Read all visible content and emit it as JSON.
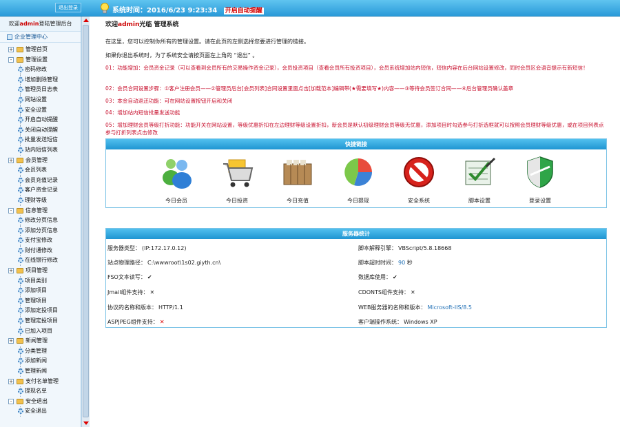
{
  "topbar": {
    "logout_label": "退出登录",
    "system_time": "系统时间：2016/6/23 9:23:34",
    "remind_label": "开启自动提醒"
  },
  "sidebar": {
    "welcome_prefix": "欢迎",
    "welcome_user": "admin",
    "welcome_suffix": "登陆管理后台",
    "center_title": "企业管理中心",
    "items": [
      {
        "type": "top",
        "pm": "+",
        "label": "管理首页"
      },
      {
        "type": "top",
        "pm": "-",
        "label": "管理设置"
      },
      {
        "type": "sub",
        "label": "密码修改"
      },
      {
        "type": "sub",
        "label": "增加删除管理"
      },
      {
        "type": "sub",
        "label": "管理员日志表"
      },
      {
        "type": "sub",
        "label": "网站设置"
      },
      {
        "type": "sub",
        "label": "安全设置"
      },
      {
        "type": "sub",
        "label": "开启自动提醒"
      },
      {
        "type": "sub",
        "label": "关闭自动提醒"
      },
      {
        "type": "sub",
        "label": "批量发送短信"
      },
      {
        "type": "sub",
        "label": "站内短信列表"
      },
      {
        "type": "top",
        "pm": "+",
        "label": "会员管理"
      },
      {
        "type": "sub",
        "label": "会员列表"
      },
      {
        "type": "sub",
        "label": "会员充值记录"
      },
      {
        "type": "sub",
        "label": "客户资金记录"
      },
      {
        "type": "sub",
        "label": "理财等级"
      },
      {
        "type": "top",
        "pm": "-",
        "label": "信息管理"
      },
      {
        "type": "sub",
        "label": "修改分页信息"
      },
      {
        "type": "sub",
        "label": "添加分页信息"
      },
      {
        "type": "sub",
        "label": "支付宝修改"
      },
      {
        "type": "sub",
        "label": "财付通修改"
      },
      {
        "type": "sub",
        "label": "在线银行修改"
      },
      {
        "type": "top",
        "pm": "+",
        "label": "项目管理"
      },
      {
        "type": "sub",
        "label": "项目类别"
      },
      {
        "type": "sub",
        "label": "添加项目"
      },
      {
        "type": "sub",
        "label": "管理项目"
      },
      {
        "type": "sub",
        "label": "添加定投项目"
      },
      {
        "type": "sub",
        "label": "管理定投项目"
      },
      {
        "type": "sub",
        "label": "已加入项目"
      },
      {
        "type": "top",
        "pm": "+",
        "label": "新闻管理"
      },
      {
        "type": "sub",
        "label": "分类管理"
      },
      {
        "type": "sub",
        "label": "添加新闻"
      },
      {
        "type": "sub",
        "label": "管理新闻"
      },
      {
        "type": "top",
        "pm": "+",
        "label": "支付名单管理"
      },
      {
        "type": "sub",
        "label": "提现名单"
      },
      {
        "type": "top",
        "pm": "-",
        "label": "安全退出"
      },
      {
        "type": "sub",
        "label": "安全退出"
      }
    ]
  },
  "main": {
    "welcome_prefix": "欢迎",
    "welcome_user": "admin",
    "welcome_suffix": "光临 管理系统",
    "intro1": "在这里，您可以控制你所有的管理设置。请在此页的左侧选择您要进行管理的链接。",
    "intro2": "如果你退出系统时，为了系统安全请按页面左上角的 “退出” 。",
    "notes": [
      "01：功能增加：会员资金记录（可以查看到会员所有的交易操作资金记录），会员投资项目（查看会员所有投资项目），会员系统增加站内短信，短信内容在后台网站设置修改，同时会员区会语音提示有新短信！",
      "02：会员合同设置步骤：①客户注册会员——②管理员后台[会员列表]合同设置里面点击[加载范本]编辑带(★需要填写★)内容——③等待会员签订合同——④后台管理员确认盖章",
      "03：本金自动返还功能：可在网站设置按钮开启和关闭",
      "04：增加站内短信批量发送功能",
      "05：增加理财会员等级打折功能：功能开关在网站设置，等级优惠折扣在左边理财等级设置折扣，新会员是默认初级理财会员等级无优惠，添加项目时勾选参与打折选框就可以按照会员理财等级优惠，或在项目列表点参与打折列表点击修改"
    ]
  },
  "quick": {
    "title": "快捷链接",
    "items": [
      {
        "label": "今日会员",
        "icon": "members-icon"
      },
      {
        "label": "今日投资",
        "icon": "shopping-cart-icon"
      },
      {
        "label": "今日充值",
        "icon": "archive-box-icon"
      },
      {
        "label": "今日提现",
        "icon": "pie-chart-icon"
      },
      {
        "label": "安全系统",
        "icon": "forbidden-icon"
      },
      {
        "label": "脚本设置",
        "icon": "checklist-icon"
      },
      {
        "label": "登录设置",
        "icon": "shield-icon"
      }
    ]
  },
  "server": {
    "title": "服务器统计",
    "left": [
      {
        "k": "服务器类型：",
        "v": "(IP:172.17.0.12)"
      },
      {
        "k": "站点物理路径：",
        "v": "C:\\wwwroot\\1s02.giyth.cn\\"
      },
      {
        "k": "FSO文本读写：",
        "v": "✔"
      },
      {
        "k": "Jmail组件支持：",
        "v": "✕"
      },
      {
        "k": "协议的名称和版本：",
        "v": "HTTP/1.1"
      },
      {
        "k": "ASPJPEG组件支持：",
        "v": "✕"
      }
    ],
    "right": [
      {
        "k": "脚本解释引擎：",
        "v": "VBScript/5.8.18668"
      },
      {
        "k": "脚本超时时间：",
        "v": "90",
        "suffix": " 秒"
      },
      {
        "k": "数据库使用：",
        "v": "✔"
      },
      {
        "k": "CDONTS组件支持：",
        "v": "✕"
      },
      {
        "k": "WEB服务器的名称和版本：",
        "v": "Microsoft-IIS/8.5"
      },
      {
        "k": "客户端操作系统：",
        "v": "Windows XP"
      }
    ]
  },
  "colors": {
    "accent": "#2a9ad8",
    "notice_red": "#c8102e"
  }
}
